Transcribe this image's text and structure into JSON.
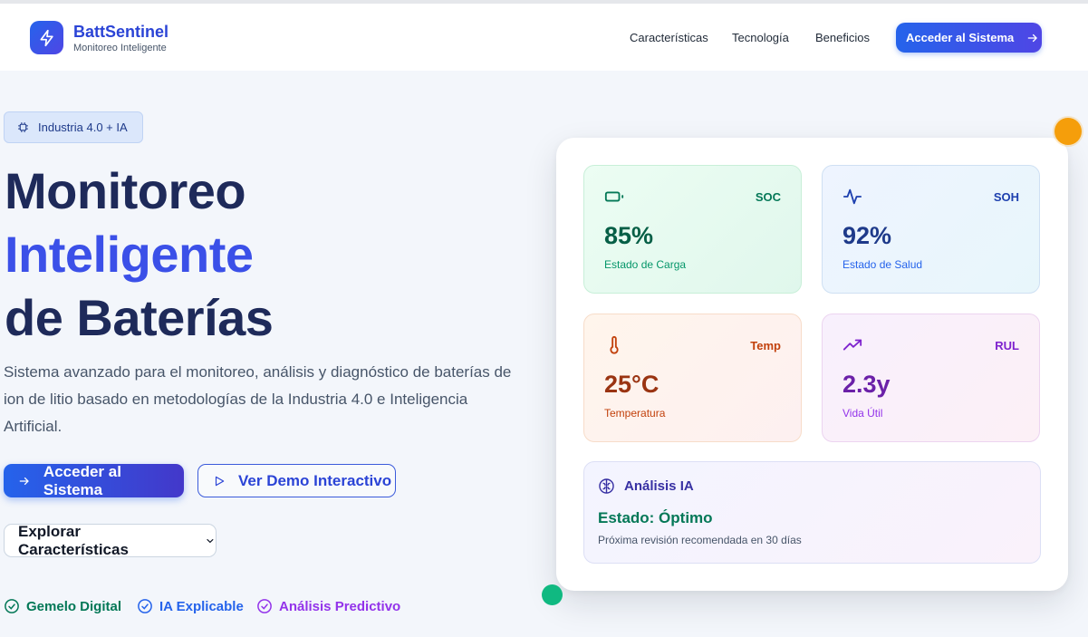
{
  "brand": {
    "name": "BattSentinel",
    "tagline": "Monitoreo Inteligente",
    "logo_icon": "lightning-bolt-icon"
  },
  "nav": {
    "links": [
      "Características",
      "Tecnología",
      "Beneficios"
    ],
    "cta": "Acceder al Sistema"
  },
  "hero": {
    "badge": "Industria 4.0 + IA",
    "title_line1": "Monitoreo",
    "title_line2": "Inteligente",
    "title_line3": "de Baterías",
    "description": "Sistema avanzado para el monitoreo, análisis y diagnóstico de baterías de ion de litio basado en metodologías de la Industria 4.0 e Inteligencia Artificial.",
    "primary_button": "Acceder al Sistema",
    "secondary_button": "Ver Demo Interactivo",
    "explore_button": "Explorar Características",
    "features": [
      "Gemelo Digital",
      "IA Explicable",
      "Análisis Predictivo"
    ]
  },
  "dashboard": {
    "soc": {
      "tag": "SOC",
      "value": "85%",
      "label": "Estado de Carga"
    },
    "soh": {
      "tag": "SOH",
      "value": "92%",
      "label": "Estado de Salud"
    },
    "temp": {
      "tag": "Temp",
      "value": "25°C",
      "label": "Temperatura"
    },
    "rul": {
      "tag": "RUL",
      "value": "2.3y",
      "label": "Vida Útil"
    },
    "ai": {
      "title": "Análisis IA",
      "status": "Estado: Óptimo",
      "note": "Próxima revisión recomendada en 30 días"
    }
  },
  "colors": {
    "primary": "#2563eb",
    "indigo": "#4f46e5",
    "green": "#047857",
    "orange": "#f59e0b",
    "purple": "#7e22ce"
  }
}
